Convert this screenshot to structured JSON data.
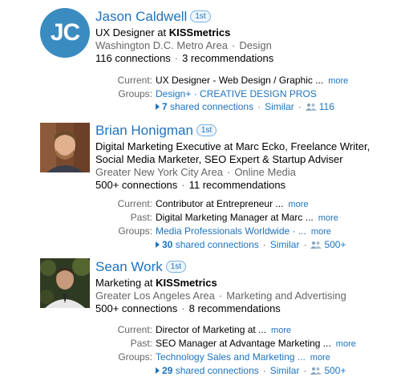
{
  "results": [
    {
      "name": "Jason Caldwell",
      "degree": "1st",
      "headline_prefix": "UX Designer at ",
      "headline_company": "KISSmetrics",
      "location": "Washington D.C. Metro Area",
      "industry": "Design",
      "connections": "116 connections",
      "recommendations": "3 recommendations",
      "logo_text": "JC",
      "current": "UX Designer - Web Design / Graphic ...",
      "groups": "Design+ · CREATIVE DESIGN PROS",
      "shared_count": "7",
      "shared_label": " shared connections",
      "similar": "Similar",
      "people_count": "116",
      "more": "more"
    },
    {
      "name": "Brian Honigman",
      "degree": "1st",
      "headline_1": "Digital Marketing Executive at Marc Ecko, Freelance Writer,",
      "headline_2": "Social Media Marketer, SEO Expert & Startup Adviser",
      "location": "Greater New York City Area",
      "industry": "Online Media",
      "connections": "500+ connections",
      "recommendations": "11 recommendations",
      "current": "Contributor at Entrepreneur ...",
      "past": "Digital Marketing Manager at Marc ...",
      "groups": "Media Professionals Worldwide · ...",
      "shared_count": "30",
      "shared_label": " shared connections",
      "similar": "Similar",
      "people_count": "500+",
      "more": "more"
    },
    {
      "name": "Sean Work",
      "degree": "1st",
      "headline_prefix": "Marketing at ",
      "headline_company": "KISSmetrics",
      "location": "Greater Los Angeles Area",
      "industry": "Marketing and Advertising",
      "connections": "500+ connections",
      "recommendations": "8 recommendations",
      "current": "Director of Marketing at ...",
      "past": "SEO Manager at Advantage Marketing ...",
      "groups": "Technology Sales and Marketing ...",
      "shared_count": "29",
      "shared_label": " shared connections",
      "similar": "Similar",
      "people_count": "500+",
      "more": "more"
    }
  ],
  "labels": {
    "current": "Current:",
    "past": "Past:",
    "groups": "Groups:"
  },
  "colors": {
    "link": "#1e73be",
    "muted": "#666666",
    "logo_bg": "#3a8cc0"
  },
  "icons": {
    "people": "people-icon",
    "expand": "triangle-right-icon"
  }
}
